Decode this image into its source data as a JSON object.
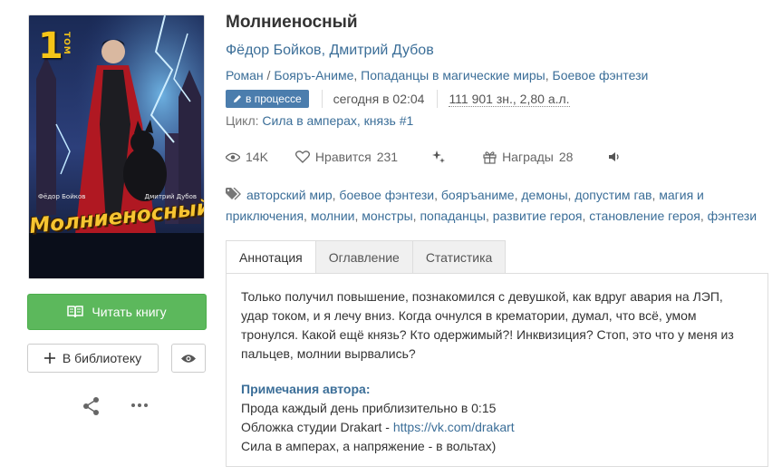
{
  "book": {
    "title": "Молниеносный",
    "authors": [
      "Фёдор Бойков",
      "Дмитрий Дубов"
    ],
    "author_sep": ", ",
    "genres": {
      "first": "Роман",
      "rest": [
        "Бояръ-Аниме",
        "Попаданцы в магические миры",
        "Боевое фэнтези"
      ]
    },
    "status_badge": "в процессе",
    "updated": "сегодня в 02:04",
    "size": "111 901 зн., 2,80 а.л.",
    "cycle_label": "Цикл:",
    "cycle_link": "Сила в амперах, князь #1"
  },
  "cover": {
    "tom_num": "1",
    "tom_word": "ТОМ",
    "author_left": "Фёдор Бойков",
    "author_right": "Дмитрий Дубов",
    "title": "Молниеносный"
  },
  "stats": {
    "views": "14K",
    "likes_label": "Нравится",
    "likes": "231",
    "awards_label": "Награды",
    "awards": "28"
  },
  "tags": [
    "авторский мир",
    "боевое фэнтези",
    "бояръаниме",
    "демоны",
    "допустим гав",
    "магия и приключения",
    "молнии",
    "монстры",
    "попаданцы",
    "развитие героя",
    "становление героя",
    "фэнтези"
  ],
  "buttons": {
    "read": "Читать книгу",
    "library": "В библиотеку"
  },
  "tabs": [
    "Аннотация",
    "Оглавление",
    "Статистика"
  ],
  "annotation": {
    "text": "Только получил повышение, познакомился с девушкой, как вдруг авария на ЛЭП, удар током, и я лечу вниз. Когда очнулся в крематории, думал, что всё, умом тронулся. Какой ещё князь? Кто одержимый?! Инквизиция? Стоп, это что у меня из пальцев, молнии вырвались?",
    "notes_title": "Примечания автора:",
    "note_line1": "Прода каждый день приблизительно в 0:15",
    "note_line2_prefix": "Обложка студии Drakart - ",
    "note_line2_link": "https://vk.com/drakart",
    "note_line3": "Сила в амперах, а напряжение - в вольтах)"
  },
  "colors": {
    "accent": "#3b6e98",
    "read_button": "#5cb85c",
    "badge": "#4b7dad"
  }
}
